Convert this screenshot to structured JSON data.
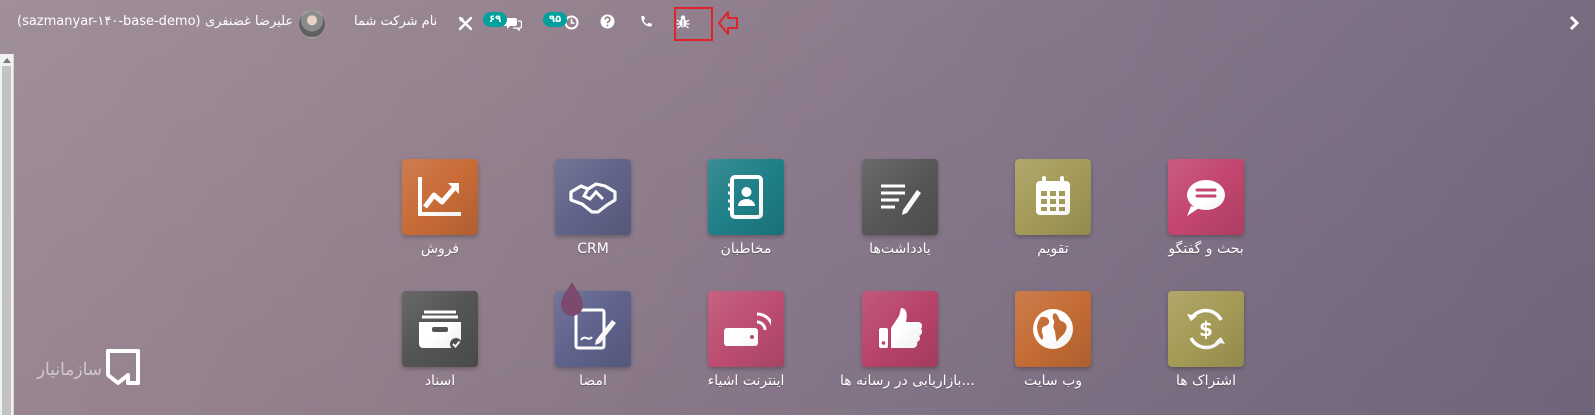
{
  "colors": {
    "badge": "#00a09d",
    "highlight_box": "#e0222a"
  },
  "topbar": {
    "db_name": "(sazmanyar-۱۴۰-base-demo)",
    "user_name": "علیرضا غضنفری",
    "company_name": "نام شرکت شما",
    "messages_badge": "۶۹",
    "activities_badge": "۹۵",
    "icons": [
      "user-avatar",
      "settings-cross-icon",
      "chat-icon",
      "clock-icon",
      "help-icon",
      "phone-icon",
      "bug-icon",
      "menu-chevron-icon"
    ]
  },
  "apps": [
    {
      "label": "بحث و گفتگو",
      "icon": "chat-bubble-icon",
      "color": "#c3466e"
    },
    {
      "label": "تقویم",
      "icon": "calendar-icon",
      "color": "#a49b59"
    },
    {
      "label": "یادداشت‌ها",
      "icon": "notes-icon",
      "color": "#575757"
    },
    {
      "label": "مخاطبان",
      "icon": "address-book-icon",
      "color": "#1f7f87"
    },
    {
      "label": "CRM",
      "icon": "handshake-icon",
      "color": "#616389"
    },
    {
      "label": "فروش",
      "icon": "sales-chart-icon",
      "color": "#c86b37"
    },
    {
      "label": "اشتراک ها",
      "icon": "subscription-icon",
      "color": "#a59b57"
    },
    {
      "label": "وب سایت",
      "icon": "globe-icon",
      "color": "#c46c35"
    },
    {
      "label": "بازاریابی در رسانه ها...",
      "icon": "thumbs-up-icon",
      "color": "#b8436a"
    },
    {
      "label": "اینترنت اشیاء",
      "icon": "iot-icon",
      "color": "#bd4d72"
    },
    {
      "label": "امضا",
      "icon": "sign-icon",
      "color": "#5f638c"
    },
    {
      "label": "اسناد",
      "icon": "documents-icon",
      "color": "#545454"
    }
  ],
  "watermark": {
    "text": "سازمانیار"
  }
}
